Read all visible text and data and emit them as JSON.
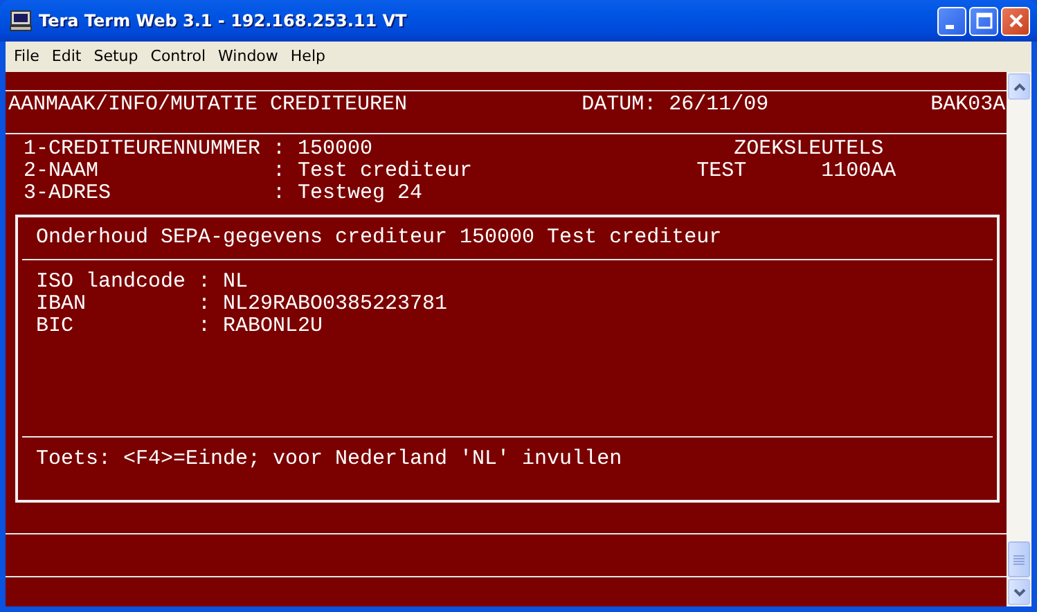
{
  "window": {
    "title": "Tera Term Web 3.1 - 192.168.253.11 VT"
  },
  "menu": [
    "File",
    "Edit",
    "Setup",
    "Control",
    "Window",
    "Help"
  ],
  "terminal": {
    "header": {
      "title": "AANMAAK/INFO/MUTATIE CREDITEUREN",
      "date_label": "DATUM:",
      "date": "26/11/09",
      "code": "BAK03A"
    },
    "fields": [
      {
        "label": "1-CREDITEURENNUMMER",
        "value": ": 150000"
      },
      {
        "label": "2-NAAM",
        "value": ": Test crediteur"
      },
      {
        "label": "3-ADRES",
        "value": ": Testweg 24"
      }
    ],
    "search_keys": {
      "title": "ZOEKSLEUTELS",
      "values": [
        "TEST",
        "1100AA"
      ]
    },
    "dialog": {
      "title": "Onderhoud SEPA-gegevens crediteur 150000 Test crediteur",
      "fields": [
        {
          "label": "ISO landcode",
          "value": ": NL"
        },
        {
          "label": "IBAN",
          "value": ": NL29RABO0385223781"
        },
        {
          "label": "BIC",
          "value": ": RABONL2U"
        }
      ],
      "hint": "Toets: <F4>=Einde; voor Nederland 'NL' invullen"
    }
  }
}
